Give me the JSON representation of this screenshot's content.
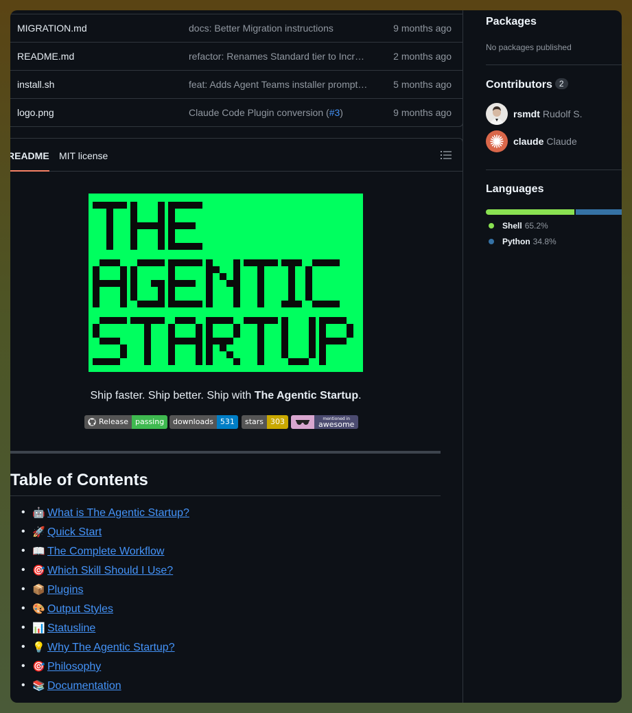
{
  "files": [
    {
      "name": "MIGRATION.md",
      "message": "docs: Better Migration instructions",
      "time": "9 months ago"
    },
    {
      "name": "README.md",
      "message": "refactor: Renames Standard tier to Incr…",
      "time": "2 months ago"
    },
    {
      "name": "install.sh",
      "message": "feat: Adds Agent Teams installer prompt…",
      "time": "5 months ago"
    },
    {
      "name": "logo.png",
      "message_prefix": "Claude Code Plugin conversion (",
      "message_link": "#3",
      "message_suffix": ")",
      "time": "9 months ago"
    }
  ],
  "readme": {
    "tab_readme": "README",
    "tab_license": "MIT license",
    "logo_lines": [
      "THE",
      "AGENTIC",
      "STARTUP"
    ],
    "tagline_prefix": "Ship faster. Ship better. Ship with ",
    "tagline_bold": "The Agentic Startup",
    "tagline_suffix": ".",
    "badges": [
      {
        "left": "Release",
        "right": "passing",
        "color": "#4c1"
      },
      {
        "left": "downloads",
        "right": "531",
        "color": "#007ec6"
      },
      {
        "left": "stars",
        "right": "303",
        "color": "#dfb317"
      },
      {
        "left": "mentioned in",
        "right": "awesome",
        "color": "#4b4b70"
      }
    ],
    "toc_title": "Table of Contents",
    "toc": [
      {
        "emoji": "🤖",
        "label": "What is The Agentic Startup?"
      },
      {
        "emoji": "🚀",
        "label": "Quick Start"
      },
      {
        "emoji": "📖",
        "label": "The Complete Workflow"
      },
      {
        "emoji": "🎯",
        "label": "Which Skill Should I Use?"
      },
      {
        "emoji": "📦",
        "label": "Plugins"
      },
      {
        "emoji": "🎨",
        "label": "Output Styles"
      },
      {
        "emoji": "📊",
        "label": "Statusline"
      },
      {
        "emoji": "💡",
        "label": "Why The Agentic Startup?"
      },
      {
        "emoji": "🎯",
        "label": "Philosophy"
      },
      {
        "emoji": "📚",
        "label": "Documentation"
      }
    ]
  },
  "sidebar": {
    "packages_title": "Packages",
    "packages_text": "No packages published",
    "contributors_title": "Contributors",
    "contributors_count": "2",
    "contributors": [
      {
        "login": "rsmdt",
        "name": "Rudolf S."
      },
      {
        "login": "claude",
        "name": "Claude"
      }
    ],
    "languages_title": "Languages",
    "languages": [
      {
        "name": "Shell",
        "percent": "65.2%",
        "value": 65.2,
        "color": "#89e051"
      },
      {
        "name": "Python",
        "percent": "34.8%",
        "value": 34.8,
        "color": "#3572A5"
      }
    ]
  }
}
